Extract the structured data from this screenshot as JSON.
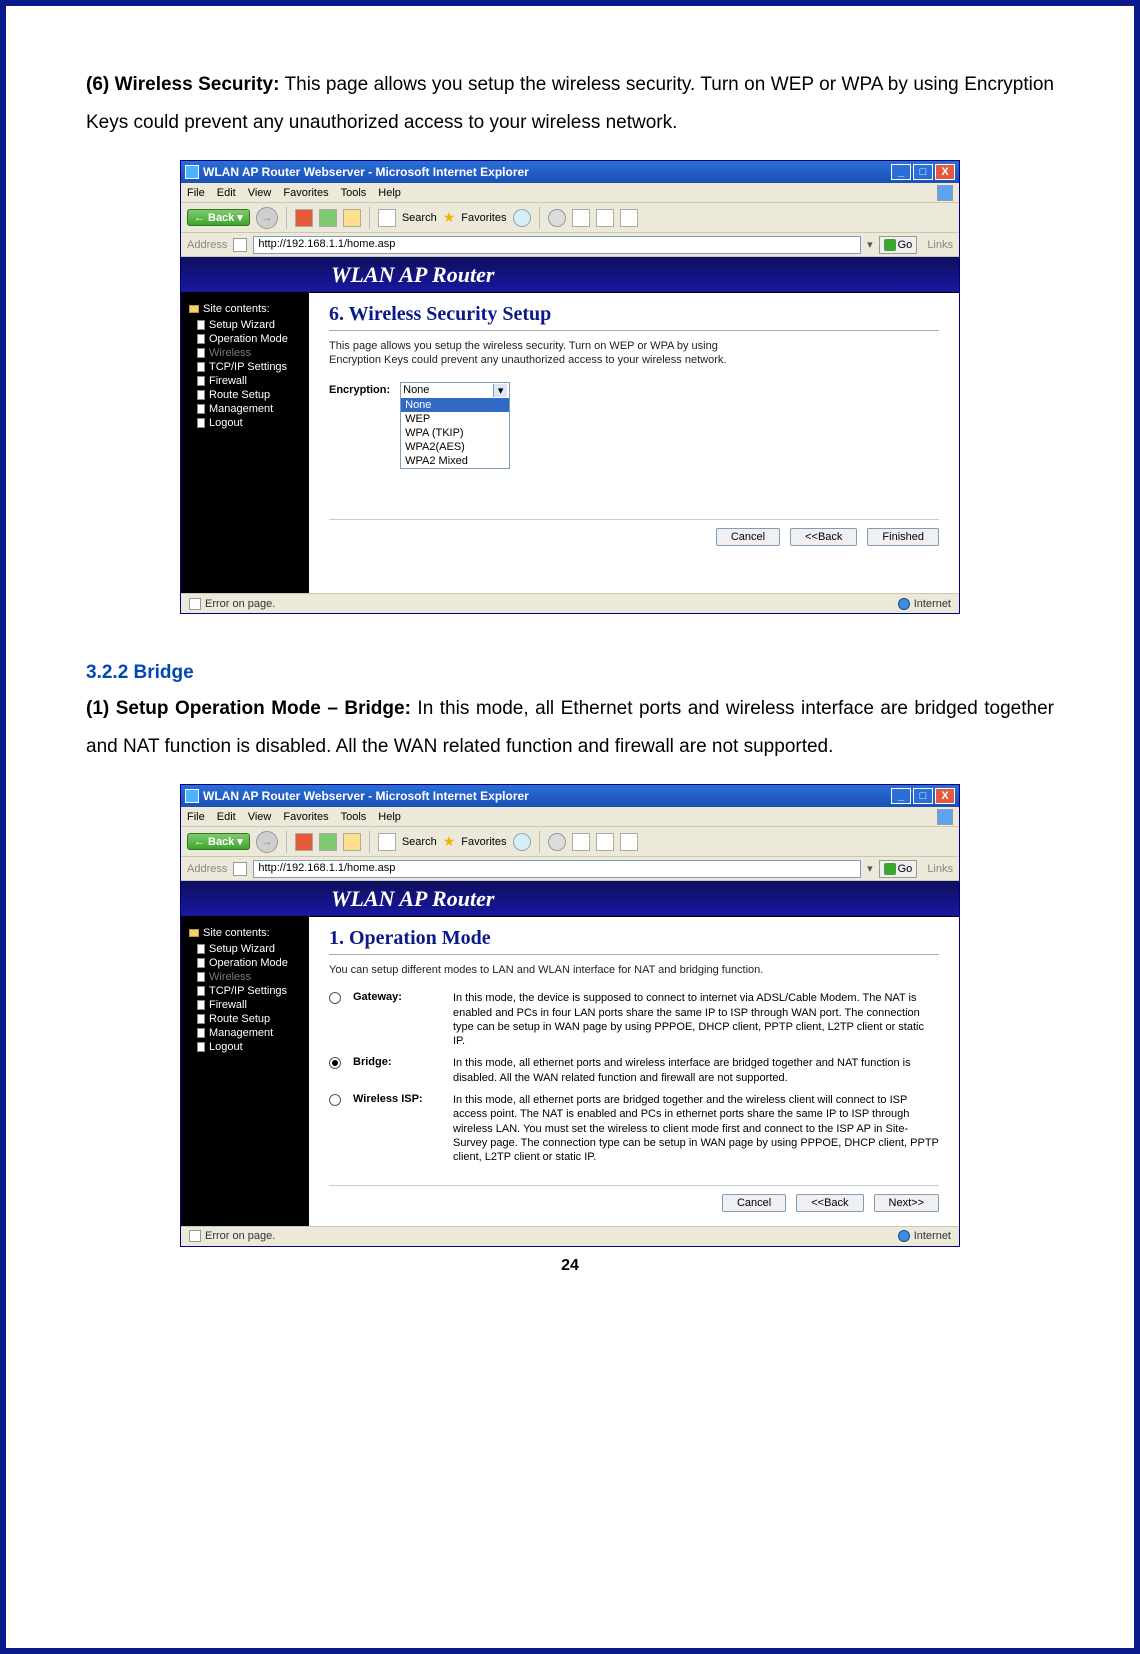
{
  "doc": {
    "para1_prefix": "(6) Wireless Security:",
    "para1": " This page allows you setup the wireless security. Turn on WEP or WPA by using Encryption Keys could prevent any unauthorized access to your wireless network.",
    "section_heading": "3.2.2 Bridge",
    "para2_prefix": "(1) Setup Operation Mode – Bridge:",
    "para2": " In this mode, all Ethernet ports and wireless interface are bridged together and NAT function is disabled. All the WAN related function and firewall are not supported.",
    "page_number": "24"
  },
  "browser": {
    "title": "WLAN AP Router Webserver - Microsoft Internet Explorer",
    "menu": [
      "File",
      "Edit",
      "View",
      "Favorites",
      "Tools",
      "Help"
    ],
    "back": "Back",
    "search": "Search",
    "favorites": "Favorites",
    "address_label": "Address",
    "url": "http://192.168.1.1/home.asp",
    "go": "Go",
    "links": "Links",
    "status_left": "Error on page.",
    "status_right": "Internet"
  },
  "router": {
    "banner": "WLAN AP Router",
    "sidebar_header": "Site contents:",
    "sidebar_items": [
      {
        "label": "Setup Wizard",
        "muted": false
      },
      {
        "label": "Operation Mode",
        "muted": false
      },
      {
        "label": "Wireless",
        "muted": true
      },
      {
        "label": "TCP/IP Settings",
        "muted": false
      },
      {
        "label": "Firewall",
        "muted": false
      },
      {
        "label": "Route Setup",
        "muted": false
      },
      {
        "label": "Management",
        "muted": false
      },
      {
        "label": "Logout",
        "muted": false
      }
    ]
  },
  "shot1": {
    "title": "6. Wireless Security Setup",
    "desc": "This page allows you setup the wireless security. Turn on WEP or WPA by using Encryption Keys could prevent any unauthorized access to your wireless network.",
    "enc_label": "Encryption:",
    "enc_selected": "None",
    "enc_options": [
      "None",
      "WEP",
      "WPA (TKIP)",
      "WPA2(AES)",
      "WPA2 Mixed"
    ],
    "btn_cancel": "Cancel",
    "btn_back": "<<Back",
    "btn_finish": "Finished"
  },
  "shot2": {
    "title": "1. Operation Mode",
    "desc": "You can setup different modes to LAN and WLAN interface for NAT and bridging function.",
    "modes": [
      {
        "name": "Gateway:",
        "checked": false,
        "desc": "In this mode, the device is supposed to connect to internet via ADSL/Cable Modem. The NAT is enabled and PCs in four LAN ports share the same IP to ISP through WAN port. The connection type can be setup in WAN page by using PPPOE, DHCP client, PPTP client, L2TP client or static IP."
      },
      {
        "name": "Bridge:",
        "checked": true,
        "desc": "In this mode, all ethernet ports and wireless interface are bridged together and NAT function is disabled. All the WAN related function and firewall are not supported."
      },
      {
        "name": "Wireless ISP:",
        "checked": false,
        "desc": "In this mode, all ethernet ports are bridged together and the wireless client will connect to ISP access point. The NAT is enabled and PCs in ethernet ports share the same IP to ISP through wireless LAN. You must set the wireless to client mode first and connect to the ISP AP in Site-Survey page. The connection type can be setup in WAN page by using PPPOE, DHCP client, PPTP client, L2TP client or static IP."
      }
    ],
    "btn_cancel": "Cancel",
    "btn_back": "<<Back",
    "btn_next": "Next>>"
  }
}
